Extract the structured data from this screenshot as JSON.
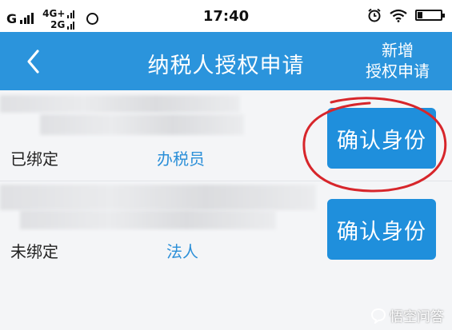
{
  "status_bar": {
    "carrier": "G",
    "network_primary": "4G+",
    "network_secondary": "2G",
    "time": "17:40",
    "battery_level": 0.2,
    "icons": [
      "signal-icon",
      "chat-icon",
      "alarm-icon",
      "wifi-icon",
      "battery-icon"
    ]
  },
  "nav": {
    "back_icon": "chevron-left-icon",
    "title": "纳税人授权申请",
    "action_line1": "新增",
    "action_line2": "授权申请"
  },
  "rows": [
    {
      "status": "已绑定",
      "role": "办税员",
      "button_label": "确认身份"
    },
    {
      "status": "未绑定",
      "role": "法人",
      "button_label": "确认身份"
    }
  ],
  "watermark": {
    "text": "悟空问答"
  },
  "colors": {
    "nav_bg": "#2b94dc",
    "button_bg": "#1f8fdc",
    "role_text": "#2b8fd8",
    "annotation_circle": "#d7262b",
    "page_bg": "#f4f5f7"
  }
}
